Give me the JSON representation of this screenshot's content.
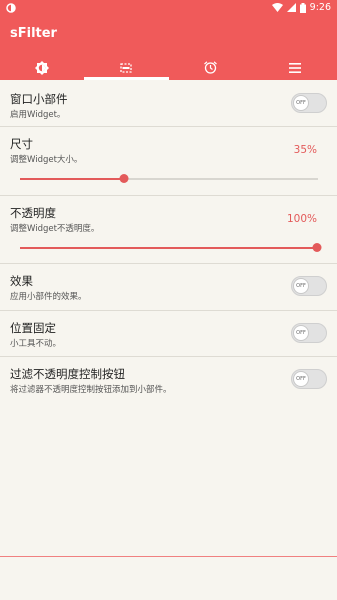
{
  "status_bar": {
    "time": "9:26"
  },
  "app": {
    "title": "sFilter"
  },
  "tabs": [
    {
      "icon": "brightness-icon",
      "active": false
    },
    {
      "icon": "widget-icon",
      "active": true
    },
    {
      "icon": "alarm-icon",
      "active": false
    },
    {
      "icon": "menu-icon",
      "active": false
    }
  ],
  "settings": {
    "widget": {
      "label": "窗口小部件",
      "sub": "启用Widget。",
      "toggle": "OFF"
    },
    "size": {
      "label": "尺寸",
      "sub": "调整Widget大小。",
      "value": "35%",
      "level": 0.35
    },
    "opacity": {
      "label": "不透明度",
      "sub": "调整Widget不透明度。",
      "value": "100%",
      "level": 1.0
    },
    "effect": {
      "label": "效果",
      "sub": "应用小部件的效果。",
      "toggle": "OFF"
    },
    "fixed": {
      "label": "位置固定",
      "sub": "小工具不动。",
      "toggle": "OFF"
    },
    "filter_button": {
      "label": "过滤不透明度控制按钮",
      "sub": "将过滤器不透明度控制按钮添加到小部件。",
      "toggle": "OFF"
    }
  },
  "colors": {
    "accent": "#f05a5a",
    "slider": "#e35a5a",
    "background": "#f7f5ef"
  }
}
